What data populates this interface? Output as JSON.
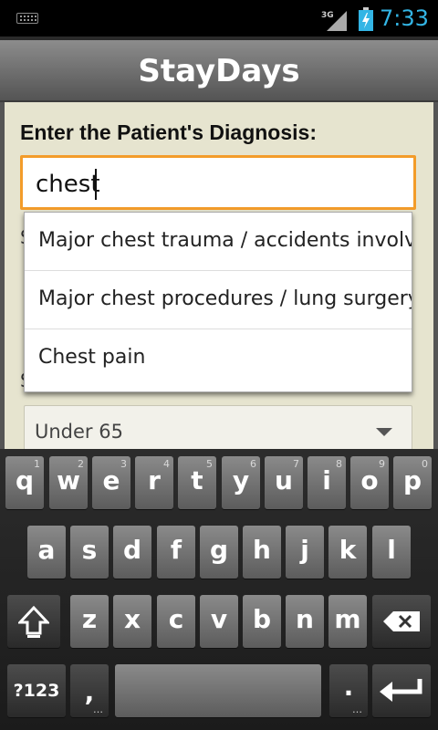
{
  "status_bar": {
    "network": "3G",
    "time": "7:33",
    "accent_color": "#33b5e5"
  },
  "app": {
    "title": "StayDays"
  },
  "form": {
    "diagnosis_label": "Enter the Patient's Diagnosis:",
    "diagnosis_value": "chest",
    "partial_label_1": "S",
    "partial_label_2": "S",
    "age_selected": "Under 65"
  },
  "suggestions": [
    "Major chest trauma / accidents involving the chest",
    "Major chest procedures / lung surgery",
    "Chest pain"
  ],
  "keyboard": {
    "row1": [
      {
        "ch": "q",
        "hint": "1"
      },
      {
        "ch": "w",
        "hint": "2"
      },
      {
        "ch": "e",
        "hint": "3"
      },
      {
        "ch": "r",
        "hint": "4"
      },
      {
        "ch": "t",
        "hint": "5"
      },
      {
        "ch": "y",
        "hint": "6"
      },
      {
        "ch": "u",
        "hint": "7"
      },
      {
        "ch": "i",
        "hint": "8"
      },
      {
        "ch": "o",
        "hint": "9"
      },
      {
        "ch": "p",
        "hint": "0"
      }
    ],
    "row2": [
      "a",
      "s",
      "d",
      "f",
      "g",
      "h",
      "j",
      "k",
      "l"
    ],
    "row3": [
      "z",
      "x",
      "c",
      "v",
      "b",
      "n",
      "m"
    ],
    "symbols_label": "?123",
    "comma": ",",
    "period": ".",
    "dots": "…"
  }
}
